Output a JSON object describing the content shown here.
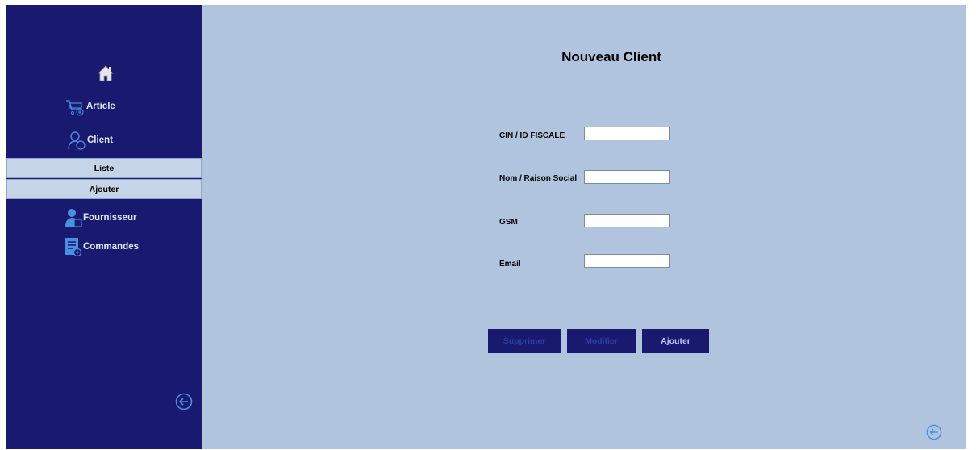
{
  "sidebar": {
    "items": [
      {
        "label": "Article",
        "icon": "cart-icon"
      },
      {
        "label": "Client",
        "icon": "user-icon"
      },
      {
        "label": "Fournisseur",
        "icon": "supplier-icon"
      },
      {
        "label": "Commandes",
        "icon": "orders-icon"
      }
    ],
    "client_submenu": [
      {
        "label": "Liste"
      },
      {
        "label": "Ajouter"
      }
    ]
  },
  "form": {
    "title": "Nouveau Client",
    "fields": [
      {
        "label": "CIN / ID FISCALE",
        "value": ""
      },
      {
        "label": "Nom / Raison Social",
        "value": ""
      },
      {
        "label": "GSM",
        "value": ""
      },
      {
        "label": "Email",
        "value": ""
      }
    ],
    "buttons": {
      "delete": "Supprimer",
      "edit": "Modifier",
      "add": "Ajouter"
    }
  },
  "colors": {
    "sidebar_bg": "#191970",
    "content_bg": "#b0c4de",
    "submenu_bg": "#c6d4e8",
    "icon_accent": "#4a90e2",
    "button_bg": "#191970",
    "button_disabled_text": "#2d3fa0",
    "button_enabled_text": "#b9c8ff"
  }
}
